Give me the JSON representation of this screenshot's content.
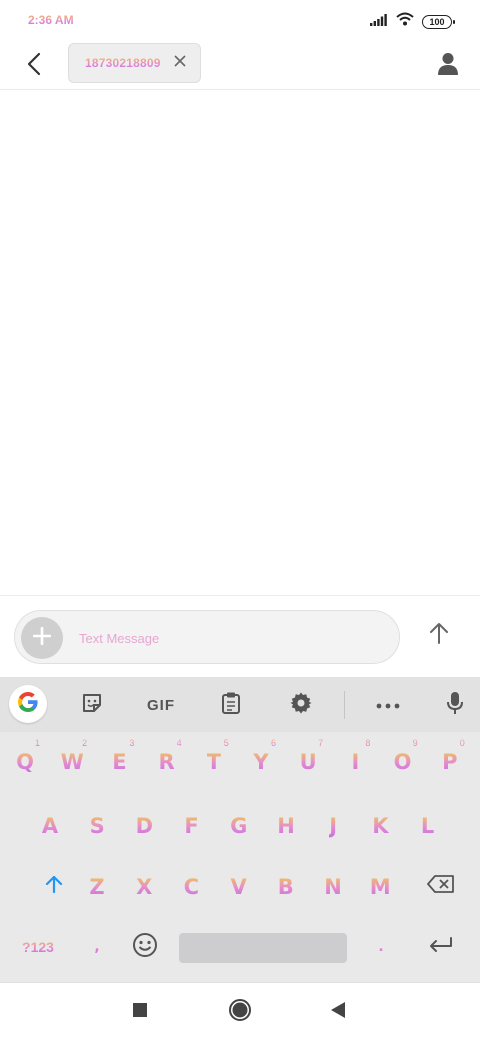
{
  "status_bar": {
    "time": "2:36 AM",
    "battery": "100",
    "icons": [
      "signal-icon",
      "wifi-icon",
      "battery-icon"
    ]
  },
  "header": {
    "recipient": "18730218809",
    "back_icon": "chevron-left-icon",
    "close_icon": "close-icon",
    "contact_icon": "person-icon"
  },
  "composer": {
    "placeholder": "Text Message",
    "value": "",
    "attach_icon": "plus-icon",
    "send_icon": "arrow-up-icon"
  },
  "keyboard": {
    "toolbar": {
      "gif_label": "GIF",
      "icons": [
        "google-icon",
        "sticker-icon",
        "gif-icon",
        "clipboard-icon",
        "settings-icon",
        "more-icon",
        "mic-icon"
      ]
    },
    "row1": [
      {
        "letter": "Q",
        "hint": "1"
      },
      {
        "letter": "W",
        "hint": "2"
      },
      {
        "letter": "E",
        "hint": "3"
      },
      {
        "letter": "R",
        "hint": "4"
      },
      {
        "letter": "T",
        "hint": "5"
      },
      {
        "letter": "Y",
        "hint": "6"
      },
      {
        "letter": "U",
        "hint": "7"
      },
      {
        "letter": "I",
        "hint": "8"
      },
      {
        "letter": "O",
        "hint": "9"
      },
      {
        "letter": "P",
        "hint": "0"
      }
    ],
    "row2": [
      "A",
      "S",
      "D",
      "F",
      "G",
      "H",
      "J",
      "K",
      "L"
    ],
    "row3": [
      "Z",
      "X",
      "C",
      "V",
      "B",
      "N",
      "M"
    ],
    "symbols_label": "?123",
    "comma": ",",
    "period": ".",
    "accent_color": "#e58ad0"
  }
}
